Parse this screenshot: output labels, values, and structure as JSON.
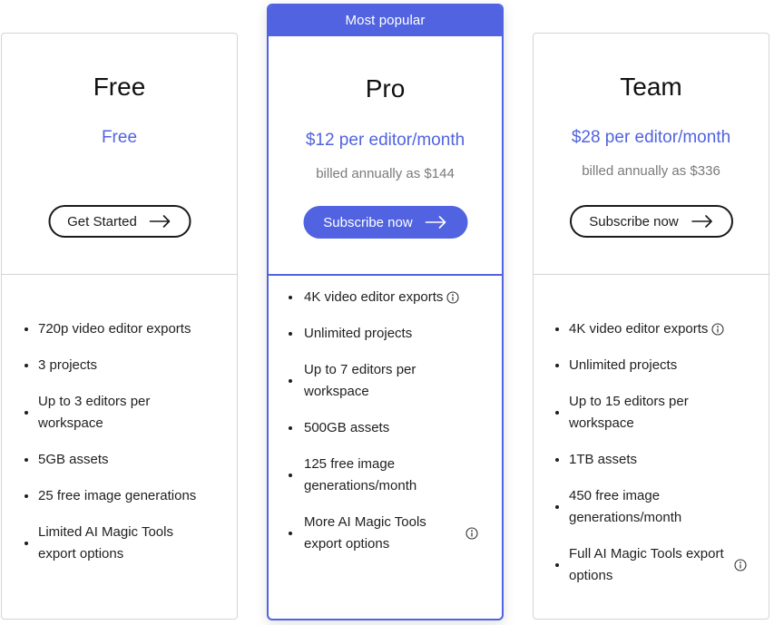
{
  "accent_color": "#5163e0",
  "plans": {
    "free": {
      "name": "Free",
      "price": "Free",
      "cta_label": "Get Started",
      "features": [
        "720p video editor exports",
        "3 projects",
        "Up to 3 editors per workspace",
        "5GB assets",
        "25 free image generations",
        "Limited AI Magic Tools export options"
      ]
    },
    "pro": {
      "badge": "Most popular",
      "name": "Pro",
      "price": "$12 per editor/month",
      "billed": "billed annually as $144",
      "cta_label": "Subscribe now",
      "features": [
        "4K video editor exports",
        "Unlimited projects",
        "Up to 7 editors per workspace",
        "500GB assets",
        "125 free image generations/month",
        "More AI Magic Tools export options"
      ]
    },
    "team": {
      "name": "Team",
      "price": "$28 per editor/month",
      "billed": "billed annually as $336",
      "cta_label": "Subscribe now",
      "features": [
        "4K video editor exports",
        "Unlimited projects",
        "Up to 15 editors per workspace",
        "1TB assets",
        "450 free image generations/month",
        "Full AI Magic Tools export options"
      ]
    }
  }
}
